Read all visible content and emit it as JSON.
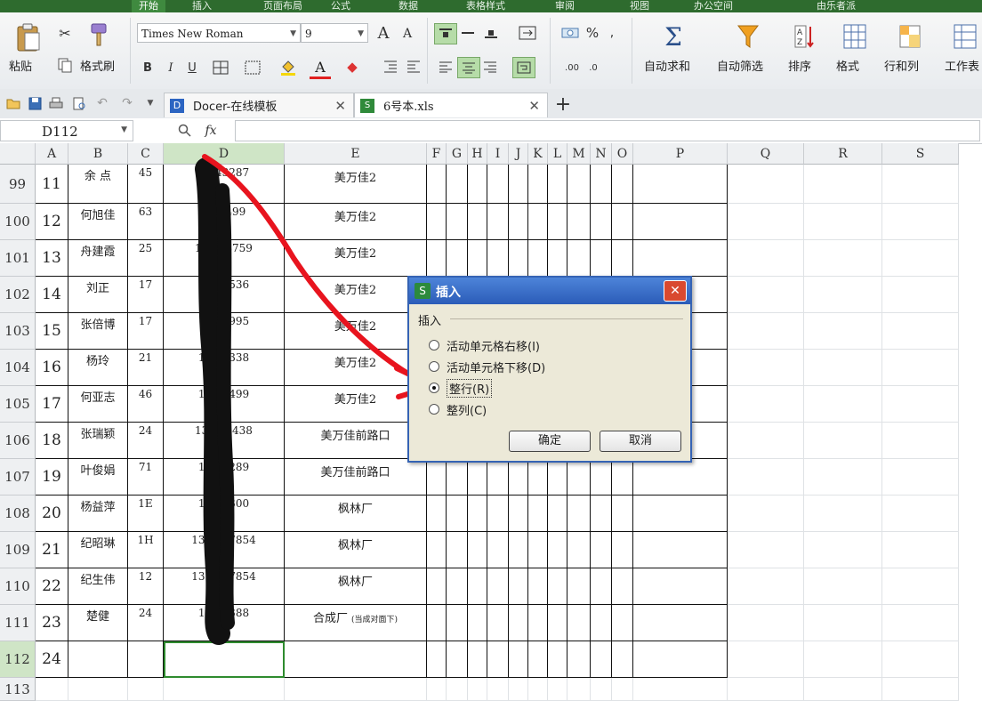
{
  "menu": {
    "tabs": [
      "开始",
      "插入",
      "页面布局",
      "公式",
      "数据",
      "表格样式",
      "审阅",
      "视图",
      "办公空间"
    ],
    "active_index": 0,
    "right_label": "由乐者派"
  },
  "ribbon": {
    "paste_label": "粘贴",
    "format_painter_label": "格式刷",
    "font_name": "Times New Roman",
    "font_size": "9",
    "grow_font": "A",
    "shrink_font": "A",
    "bold": "B",
    "italic": "I",
    "underline": "U",
    "percent": "%",
    "autosum_label": "自动求和",
    "autofilter_label": "自动筛选",
    "sort_label": "排序",
    "format_label": "格式",
    "row_col_label": "行和列",
    "worksheet_label": "工作表"
  },
  "tabs": {
    "doc1_title": "Docer-在线模板",
    "doc2_title": "6号本.xls",
    "add_label": "+"
  },
  "formula_bar": {
    "name_box": "D112",
    "fx_label": "fx",
    "content": ""
  },
  "sheet": {
    "columns": [
      "A",
      "B",
      "C",
      "D",
      "E",
      "F",
      "G",
      "H",
      "I",
      "J",
      "K",
      "L",
      "M",
      "N",
      "O",
      "P",
      "Q",
      "R",
      "S"
    ],
    "selected_column": "D",
    "selected_row": "112",
    "rows": [
      {
        "row": "99",
        "a": "11",
        "b": "余 点",
        "c": "45",
        "d": "15 43287",
        "e": "美万佳2"
      },
      {
        "row": "100",
        "a": "12",
        "b": "何旭佳",
        "c": "63",
        "d": "13 5499",
        "e": "美万佳2"
      },
      {
        "row": "101",
        "a": "13",
        "b": "舟建霞",
        "c": "25",
        "d": "150 38759",
        "e": "美万佳2"
      },
      {
        "row": "102",
        "a": "14",
        "b": "刘正",
        "c": "17",
        "d": "13 59536",
        "e": "美万佳2"
      },
      {
        "row": "103",
        "a": "15",
        "b": "张倍博",
        "c": "17",
        "d": "18 51995",
        "e": "美万佳2"
      },
      {
        "row": "104",
        "a": "16",
        "b": "杨玲",
        "c": "21",
        "d": "13 35338",
        "e": "美万佳2"
      },
      {
        "row": "105",
        "a": "17",
        "b": "何亚志",
        "c": "46",
        "d": "13 35499",
        "e": "美万佳2"
      },
      {
        "row": "106",
        "a": "18",
        "b": "张瑞颖",
        "c": "24",
        "d": "138 14438",
        "e": "美万佳前路口"
      },
      {
        "row": "107",
        "a": "19",
        "b": "叶俊娟",
        "c": "71",
        "d": "136 2289",
        "e": "美万佳前路口"
      },
      {
        "row": "108",
        "a": "20",
        "b": "杨益萍",
        "c": "1E",
        "d": "135 9300",
        "e": "枫林厂"
      },
      {
        "row": "109",
        "a": "21",
        "b": "纪昭琳",
        "c": "1H",
        "d": "1355 37854",
        "e": "枫林厂"
      },
      {
        "row": "110",
        "a": "22",
        "b": "纪生伟",
        "c": "12",
        "d": "1355 37854",
        "e": "枫林厂"
      },
      {
        "row": "111",
        "a": "23",
        "b": "楚健",
        "c": "24",
        "d": "150 4388",
        "e": "合成厂",
        "e_note": "(当成对面下)"
      },
      {
        "row": "112",
        "a": "24",
        "b": "",
        "c": "",
        "d": "",
        "e": ""
      },
      {
        "row": "113",
        "a": "",
        "b": "",
        "c": "",
        "d": "",
        "e": ""
      }
    ]
  },
  "dialog": {
    "title": "插入",
    "group_label": "插入",
    "options": [
      {
        "label": "活动单元格右移(I)",
        "selected": false
      },
      {
        "label": "活动单元格下移(D)",
        "selected": false
      },
      {
        "label": "整行(R)",
        "selected": true
      },
      {
        "label": "整列(C)",
        "selected": false
      }
    ],
    "ok_label": "确定",
    "cancel_label": "取消"
  },
  "colors": {
    "accent": "#3f8a3f",
    "annotation_arrow": "#e8141e",
    "redaction": "#111111",
    "selection": "#2e8b2e"
  }
}
